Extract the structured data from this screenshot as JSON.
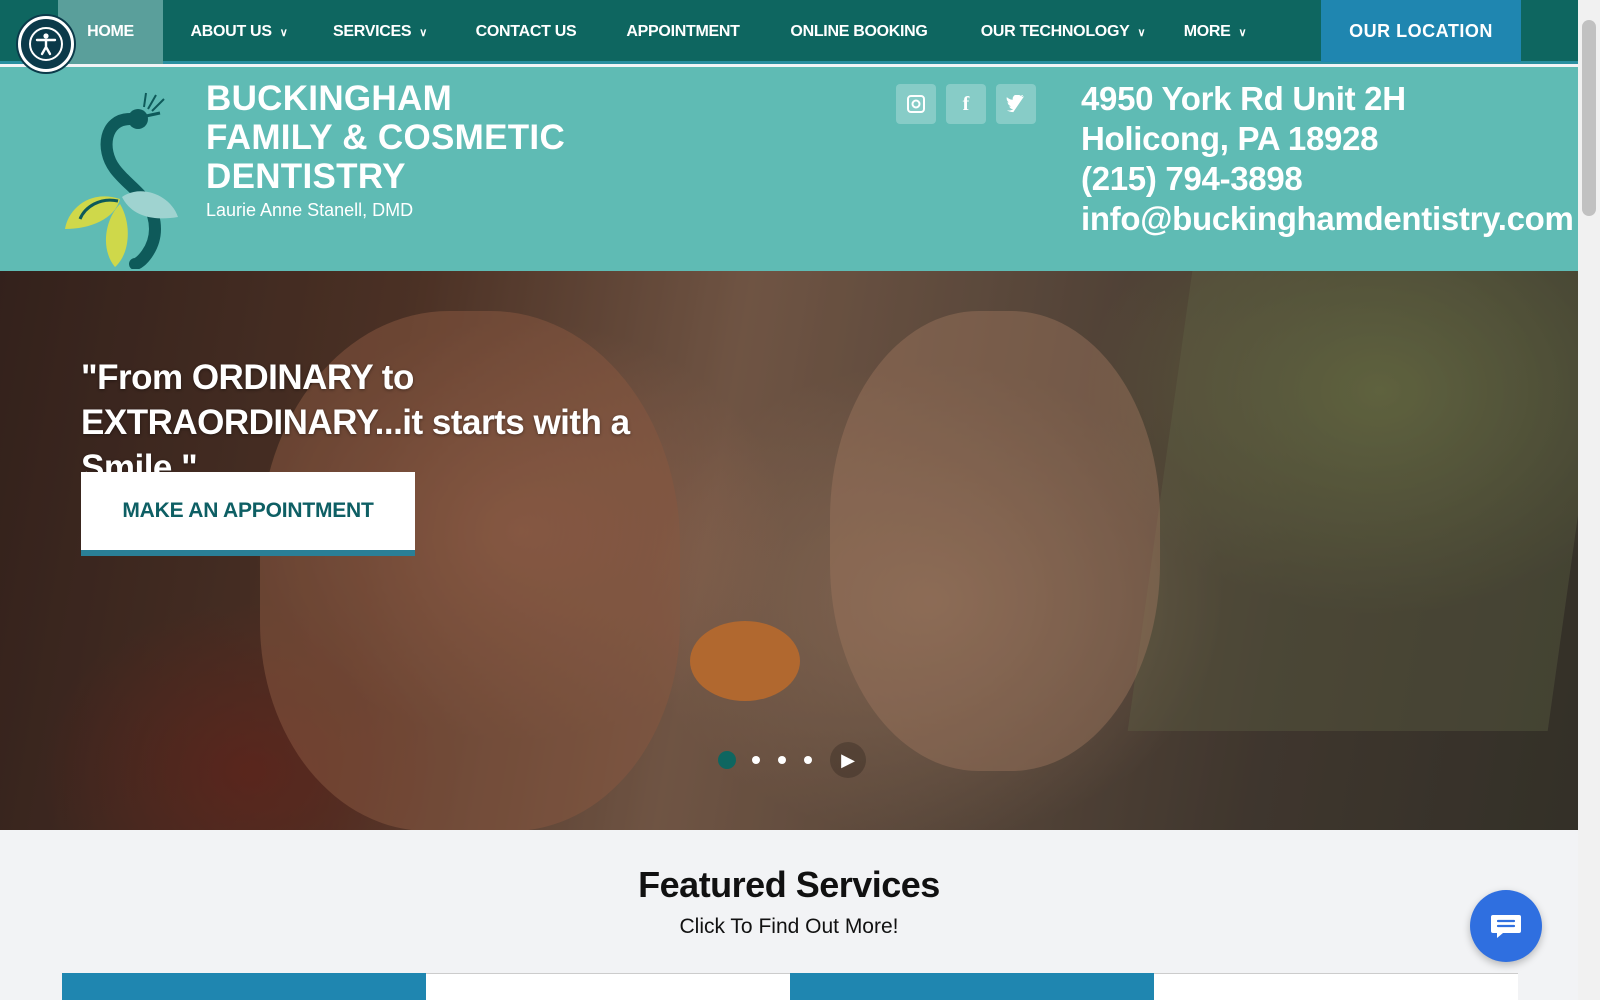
{
  "nav": {
    "items": [
      {
        "label": "HOME",
        "dropdown": false,
        "active": true
      },
      {
        "label": "ABOUT US",
        "dropdown": true,
        "active": false
      },
      {
        "label": "SERVICES",
        "dropdown": true,
        "active": false
      },
      {
        "label": "CONTACT US",
        "dropdown": false,
        "active": false
      },
      {
        "label": "APPOINTMENT",
        "dropdown": false,
        "active": false
      },
      {
        "label": "ONLINE BOOKING",
        "dropdown": false,
        "active": false
      },
      {
        "label": "OUR TECHNOLOGY",
        "dropdown": true,
        "active": false
      },
      {
        "label": "MORE",
        "dropdown": true,
        "active": false
      }
    ],
    "cta": "OUR LOCATION",
    "chevron": "⌄"
  },
  "header": {
    "brand_line1": "BUCKINGHAM",
    "brand_line2": "FAMILY & COSMETIC",
    "brand_line3": "DENTISTRY",
    "doctor": "Laurie Anne Stanell, DMD",
    "social": [
      {
        "icon": "instagram-icon",
        "glyph": "◘"
      },
      {
        "icon": "facebook-icon",
        "glyph": "f"
      },
      {
        "icon": "twitter-icon",
        "glyph": "🐦"
      }
    ],
    "address_line1": "4950 York Rd Unit 2H",
    "address_line2": "Holicong, PA 18928",
    "phone": "(215) 794-3898",
    "email": "info@buckinghamdentistry.com"
  },
  "hero": {
    "quote": "\"From ORDINARY to EXTRAORDINARY...it starts with a Smile.\"",
    "button": "MAKE AN APPOINTMENT",
    "slides": 4,
    "active_slide": 1,
    "play_glyph": "▶"
  },
  "featured": {
    "title": "Featured Services",
    "subtitle": "Click To Find Out More!"
  },
  "colors": {
    "nav": "#0e6660",
    "header": "#5fbbb4",
    "cta": "#1f86b0",
    "chat": "#2f6fe0"
  }
}
